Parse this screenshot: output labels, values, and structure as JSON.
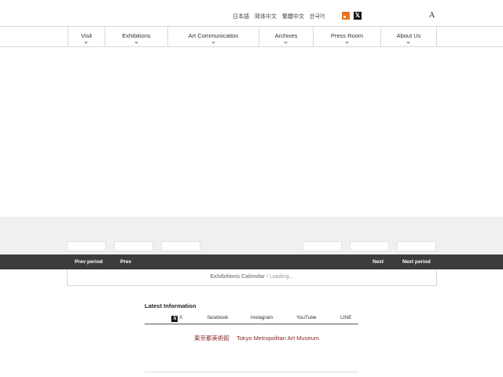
{
  "header": {
    "languages": [
      "日本語",
      "简体中文",
      "繁體中文",
      "한국어"
    ],
    "social": [
      "rss-icon",
      "x-icon"
    ],
    "font_size_label": "A"
  },
  "nav": {
    "items": [
      {
        "label": "Visit"
      },
      {
        "label": "Exhibitions"
      },
      {
        "label": "Art Communication"
      },
      {
        "label": "Archives"
      },
      {
        "label": "Press Room"
      },
      {
        "label": "About Us"
      }
    ]
  },
  "period_bar": {
    "prev_period": "Prev period",
    "prev": "Prev",
    "next": "Next",
    "next_period": "Next period"
  },
  "calendar": {
    "title": "Exhibitions Calendar",
    "status": " / Loading..."
  },
  "latest": {
    "title": "Latest Information",
    "tabs": [
      "X",
      "facebook",
      "instagram",
      "YouTube",
      "LINE"
    ],
    "museum_ja": "東京都美術館",
    "museum_en": "Tokyo Metropolitan Art Museum"
  },
  "colors": {
    "accent_red": "#8b2b2b",
    "bar_dark": "#3c3c3c",
    "rss_orange": "#e8731f"
  }
}
